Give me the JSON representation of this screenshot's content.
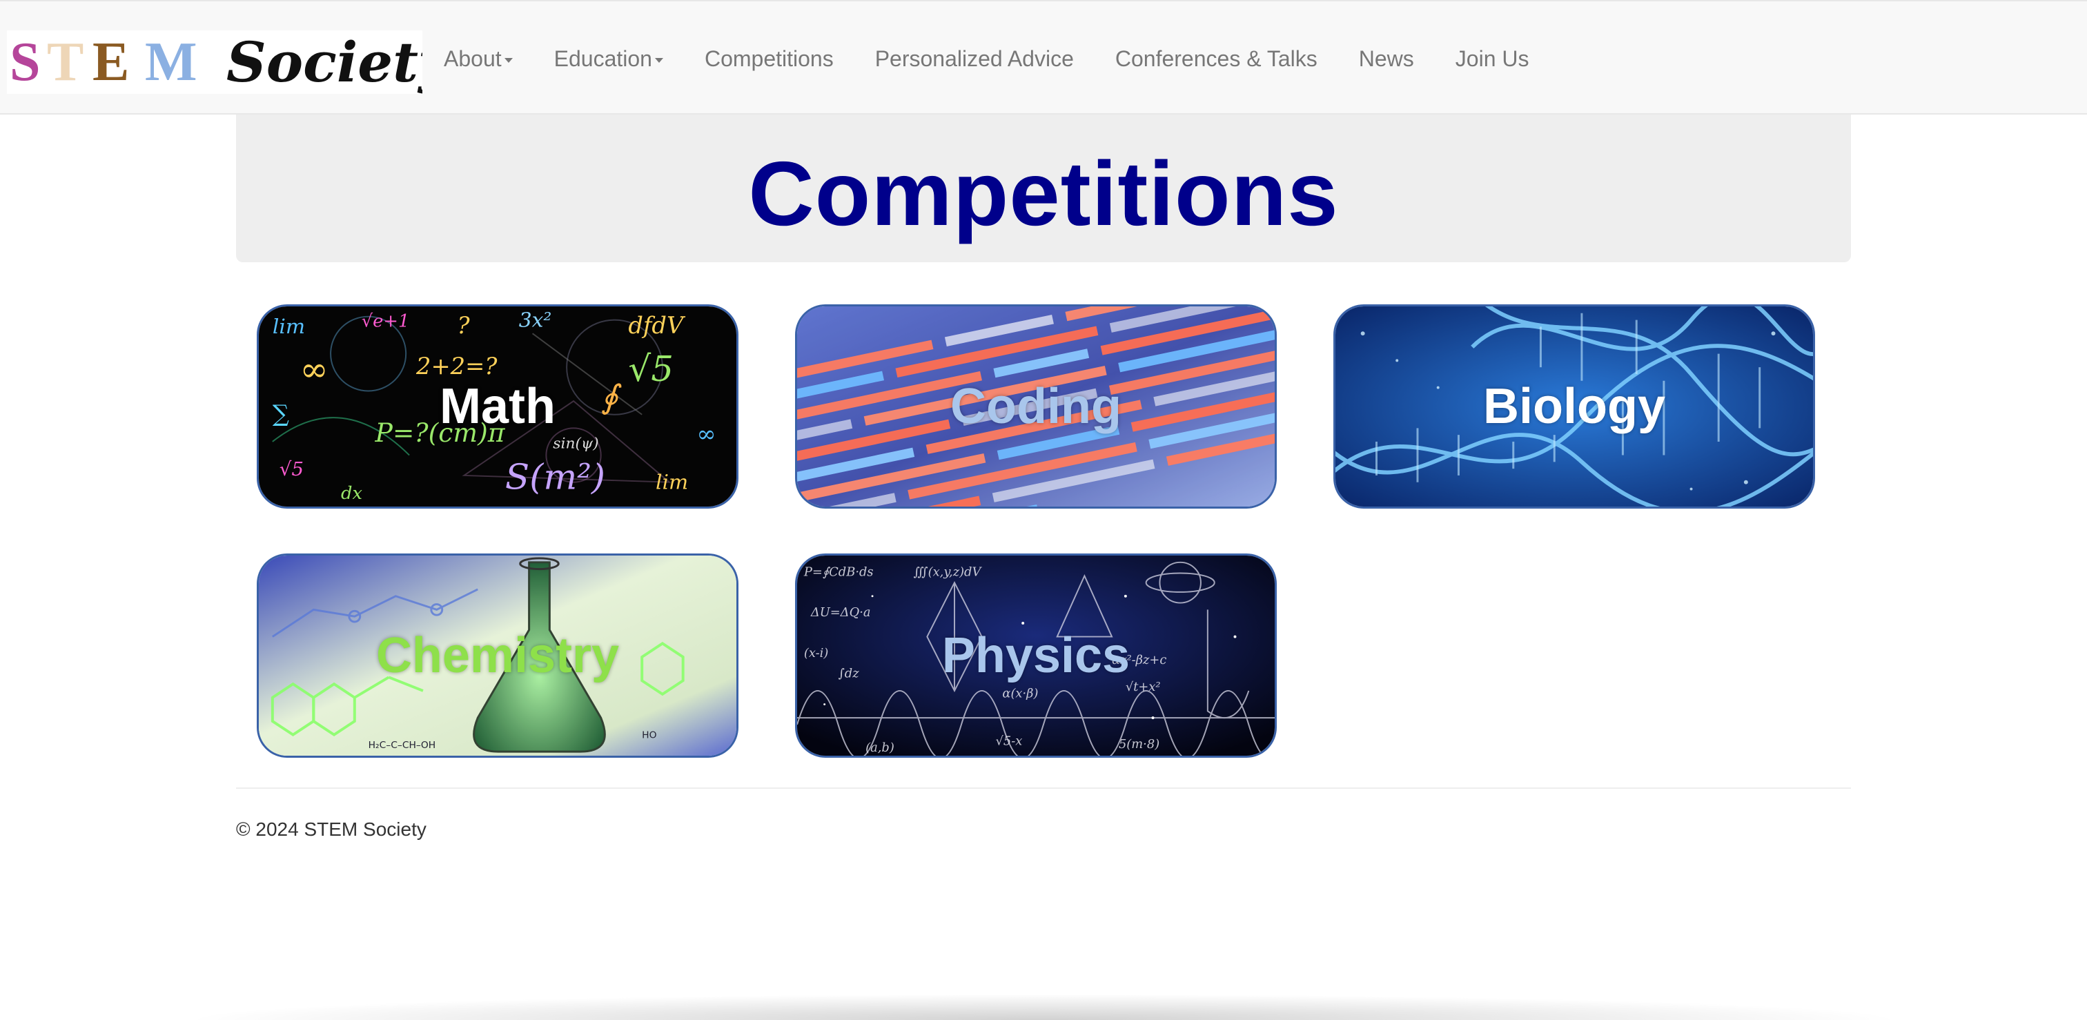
{
  "brand": {
    "logo_text": "STEM Society"
  },
  "nav": {
    "items": [
      {
        "label": "About",
        "dropdown": true
      },
      {
        "label": "Education",
        "dropdown": true
      },
      {
        "label": "Competitions",
        "dropdown": false
      },
      {
        "label": "Personalized Advice",
        "dropdown": false
      },
      {
        "label": "Conferences & Talks",
        "dropdown": false
      },
      {
        "label": "News",
        "dropdown": false
      },
      {
        "label": "Join Us",
        "dropdown": false
      }
    ]
  },
  "page": {
    "title": "Competitions"
  },
  "cards": [
    {
      "label": "Math",
      "label_color": "#ffffff"
    },
    {
      "label": "Coding",
      "label_color": "#a9c6ec"
    },
    {
      "label": "Biology",
      "label_color": "#ffffff"
    },
    {
      "label": "Chemistry",
      "label_color": "#8ee04a"
    },
    {
      "label": "Physics",
      "label_color": "#a9c6ec"
    }
  ],
  "footer": {
    "copyright": "© 2024 STEM Society"
  },
  "colors": {
    "title": "#00008b",
    "nav_text": "#777777",
    "card_border": "#3a62a8",
    "jumbotron_bg": "#eeeeee"
  }
}
